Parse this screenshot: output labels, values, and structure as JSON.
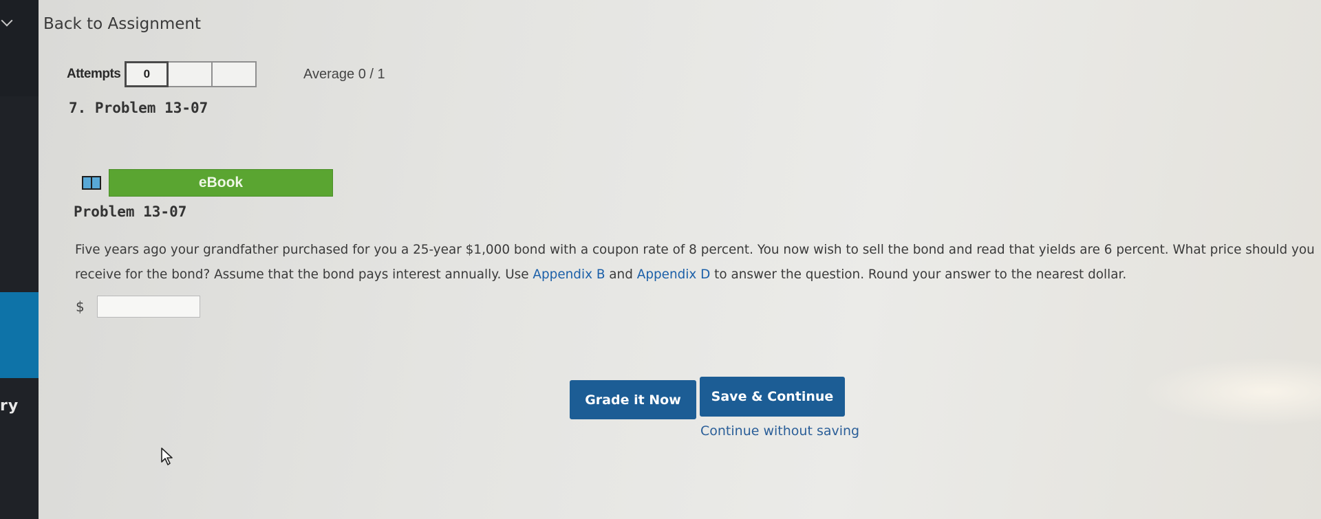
{
  "sidebar": {
    "cut_label": "ry",
    "colors": {
      "dark": "#1f2227",
      "accent": "#0e73a8"
    }
  },
  "header": {
    "back_link": "Back to Assignment"
  },
  "attempts": {
    "label": "Attempts",
    "boxes": [
      "0",
      "",
      ""
    ],
    "average": "Average 0 / 1"
  },
  "question": {
    "number_title": "7.  Problem 13-07",
    "ebook_label": "eBook",
    "title": "Problem 13-07",
    "text_line1": "Five years ago your grandfather purchased for you a 25-year $1,000 bond with a coupon rate of 8 percent. You now wish to sell the bond and read that yields are 6 percent. What price should you",
    "text_line2_start": "receive for the bond? Assume that the bond pays interest annually. Use ",
    "link_appendix_b": "Appendix B",
    "text_and": " and ",
    "link_appendix_d": "Appendix D",
    "text_line2_end": " to answer the question. Round your answer to the nearest dollar.",
    "currency_symbol": "$",
    "answer_value": ""
  },
  "actions": {
    "grade_label": "Grade it Now",
    "save_label": "Save & Continue",
    "continue_label": "Continue without saving"
  },
  "colors": {
    "primary_button": "#1c5d95",
    "ebook_green": "#5aa531",
    "link": "#1b5fa8"
  },
  "icons": {
    "ebook": "book-icon",
    "sidebar_toggle": "chevron-down-icon",
    "cursor": "mouse-pointer-icon"
  }
}
